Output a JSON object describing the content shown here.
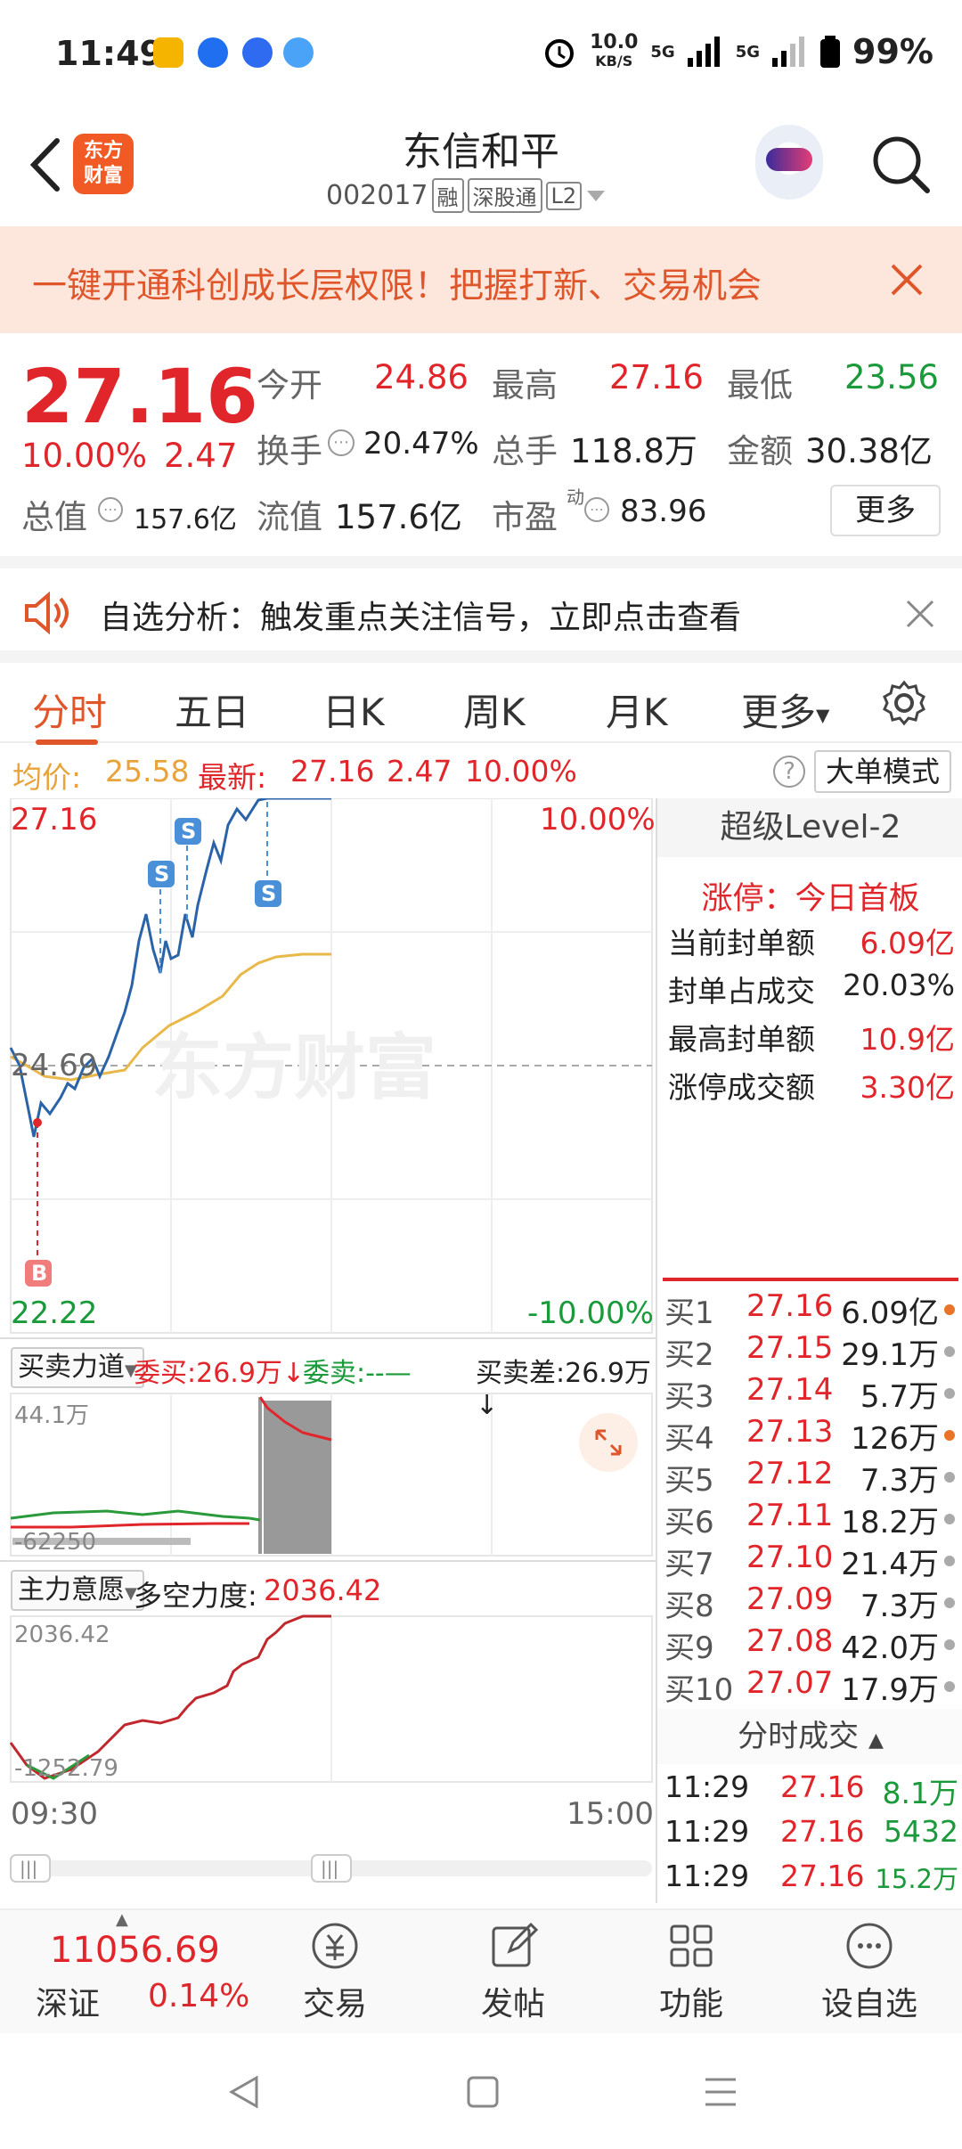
{
  "status_bar": {
    "time": "11:49",
    "speed": "10.0",
    "speed_unit": "KB/S",
    "battery": "99%",
    "net1": "5G",
    "net2": "5G"
  },
  "header": {
    "logo": "东方财富",
    "title": "东信和平",
    "code": "002017",
    "tags": [
      "融",
      "深股通",
      "L2"
    ]
  },
  "banner": {
    "text": "一键开通科创成长层权限！把握打新、交易机会"
  },
  "quote": {
    "price": "27.16",
    "change_pct": "10.00%",
    "change": "2.47",
    "open_label": "今开",
    "open": "24.86",
    "high_label": "最高",
    "high": "27.16",
    "low_label": "最低",
    "low": "23.56",
    "turnover_label": "换手",
    "turnover": "20.47%",
    "volume_label": "总手",
    "volume": "118.8万",
    "amount_label": "金额",
    "amount": "30.38亿",
    "mktcap_label": "总值",
    "mktcap": "157.6亿",
    "float_label": "流值",
    "float": "157.6亿",
    "pe_label": "市盈",
    "pe_sup": "动",
    "pe": "83.96",
    "more": "更多"
  },
  "alert": {
    "text": "自选分析：触发重点关注信号，立即点击查看"
  },
  "tabs": [
    "分时",
    "五日",
    "日K",
    "周K",
    "月K",
    "更多"
  ],
  "info_line": {
    "avg_label": "均价:",
    "avg": "25.58",
    "latest_label": "最新:",
    "latest": "27.16",
    "change": "2.47",
    "pct": "10.00%",
    "big_mode": "大单模式"
  },
  "intraday": {
    "y_top": "27.16",
    "y_mid": "24.69",
    "y_bottom": "22.22",
    "pct_top": "10.00%",
    "pct_bottom": "-10.00%",
    "watermark": "东方财富",
    "markers": [
      "S",
      "S",
      "S",
      "B"
    ]
  },
  "flow_panel": {
    "selector": "买卖力道",
    "buy_label": "委买:",
    "buy": "26.9万",
    "sell_label": "委卖:",
    "sell": "--",
    "diff_label": "买卖差:",
    "diff": "26.9万",
    "top_value": "44.1万",
    "bottom_value": "-62250"
  },
  "main_panel": {
    "selector": "主力意愿",
    "force_label": "多空力度:",
    "force": "2036.42",
    "top_value": "2036.42",
    "bottom_value": "-1252.79"
  },
  "time_axis": {
    "start": "09:30",
    "end": "15:00"
  },
  "level2": {
    "header": "超级Level-2",
    "limit_title": "涨停：今日首板",
    "rows": [
      {
        "label": "当前封单额",
        "value": "6.09亿"
      },
      {
        "label": "封单占成交",
        "value": "20.03%"
      },
      {
        "label": "最高封单额",
        "value": "10.9亿"
      },
      {
        "label": "涨停成交额",
        "value": "3.30亿"
      }
    ],
    "book": [
      {
        "label": "买1",
        "price": "27.16",
        "vol": "6.09亿",
        "dot": "#e8742a"
      },
      {
        "label": "买2",
        "price": "27.15",
        "vol": "29.1万",
        "dot": "#aaaaaa"
      },
      {
        "label": "买3",
        "price": "27.14",
        "vol": "5.7万",
        "dot": "#aaaaaa"
      },
      {
        "label": "买4",
        "price": "27.13",
        "vol": "126万",
        "dot": "#e8742a"
      },
      {
        "label": "买5",
        "price": "27.12",
        "vol": "7.3万",
        "dot": "#aaaaaa"
      },
      {
        "label": "买6",
        "price": "27.11",
        "vol": "18.2万",
        "dot": "#aaaaaa"
      },
      {
        "label": "买7",
        "price": "27.10",
        "vol": "21.4万",
        "dot": "#aaaaaa"
      },
      {
        "label": "买8",
        "price": "27.09",
        "vol": "7.3万",
        "dot": "#aaaaaa"
      },
      {
        "label": "买9",
        "price": "27.08",
        "vol": "42.0万",
        "dot": "#aaaaaa"
      },
      {
        "label": "买10",
        "price": "27.07",
        "vol": "17.9万",
        "dot": "#aaaaaa"
      }
    ],
    "ticks_header": "分时成交",
    "ticks": [
      {
        "time": "11:29",
        "price": "27.16",
        "vol": "8.1万"
      },
      {
        "time": "11:29",
        "price": "27.16",
        "vol": "5432"
      },
      {
        "time": "11:29",
        "price": "27.16",
        "vol": "15.2万"
      }
    ]
  },
  "bottom_nav": {
    "index_value": "11056.69",
    "index_name": "深证",
    "index_pct": "0.14%",
    "items": [
      "交易",
      "发帖",
      "功能",
      "设自选"
    ]
  }
}
